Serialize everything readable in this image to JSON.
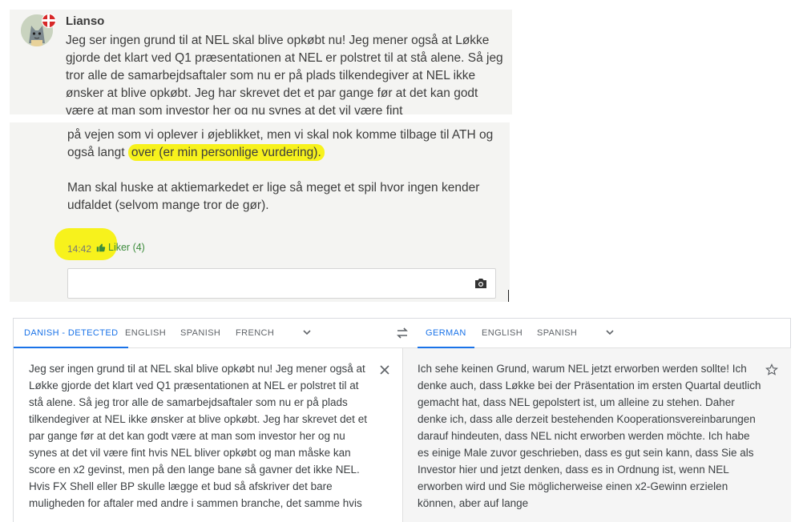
{
  "comment": {
    "author": "Lianso",
    "text_top": "Jeg ser ingen grund til at NEL skal blive opkøbt nu! Jeg mener også at Løkke gjorde det klart ved Q1 præsentationen at NEL er polstret til at stå alene. Så jeg tror alle de samarbejdsaftaler som nu er på plads tilkendegiver at NEL ikke ønsker at blive opkøbt. Jeg har skrevet det et par gange før at det kan godt være at man som investor her og nu synes at det vil være fint",
    "text_continued": "på vejen som vi oplever i øjeblikket, men vi skal nok komme tilbage til ATH og også langt",
    "text_highlighted": "over (er min personlige vurdering).",
    "paragraph2": "Man skal huske at aktiemarkedet er lige så meget et spil hvor ingen kender udfaldet (selvom mange tror de gør).",
    "time": "14:42",
    "like_label": "Liker (4)"
  },
  "translate": {
    "source_tabs": [
      "DANISH - DETECTED",
      "ENGLISH",
      "SPANISH",
      "FRENCH"
    ],
    "target_tabs": [
      "GERMAN",
      "ENGLISH",
      "SPANISH"
    ],
    "source_text": "Jeg ser ingen grund til at NEL skal blive opkøbt nu! Jeg mener også at Løkke gjorde det klart ved Q1 præsentationen at NEL er polstret til at stå alene. Så jeg tror alle de samarbejdsaftaler som nu er på plads tilkendegiver at NEL ikke ønsker at blive opkøbt. Jeg har skrevet det et par gange før at det kan godt være at man som investor her og nu synes at det vil være fint hvis NEL bliver opkøbt og man måske kan score en x2 gevinst, men på den lange bane så gavner det ikke NEL. Hvis FX Shell eller BP skulle lægge et bud så afskriver det bare muligheden for aftaler med andre i sammen branche, det samme hvis",
    "target_text": "Ich sehe keinen Grund, warum NEL jetzt erworben werden sollte! Ich denke auch, dass Løkke bei der Präsentation im ersten Quartal deutlich gemacht hat, dass NEL gepolstert ist, um alleine zu stehen. Daher denke ich, dass alle derzeit bestehenden Kooperationsvereinbarungen darauf hindeuten, dass NEL nicht erworben werden möchte. Ich habe es einige Male zuvor geschrieben, dass es gut sein kann, dass Sie als Investor hier und jetzt denken, dass es in Ordnung ist, wenn NEL erworben wird und Sie möglicherweise einen x2-Gewinn erzielen können, aber auf lange"
  },
  "colors": {
    "accent": "#1a73e8",
    "highlight": "#f7f21c",
    "like_green": "#3b8b3b"
  },
  "icons": [
    "flag-denmark-icon",
    "thumbs-up-icon",
    "camera-icon",
    "chevron-down-icon",
    "swap-icon",
    "close-icon",
    "star-icon"
  ]
}
